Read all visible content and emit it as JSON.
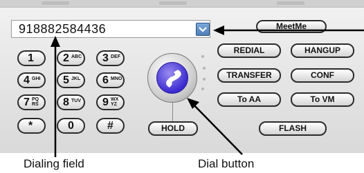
{
  "dial_field": {
    "value": "918882584436"
  },
  "keypad": [
    {
      "main": "1",
      "sub": ""
    },
    {
      "main": "2",
      "sub": "ABC"
    },
    {
      "main": "3",
      "sub": "DEF"
    },
    {
      "main": "4",
      "sub": "GHI"
    },
    {
      "main": "5",
      "sub": "JKL"
    },
    {
      "main": "6",
      "sub": "MNO"
    },
    {
      "main": "7",
      "sub": "PQ RS"
    },
    {
      "main": "8",
      "sub": "TUV"
    },
    {
      "main": "9",
      "sub": "WX YZ"
    },
    {
      "main": "*",
      "sub": ""
    },
    {
      "main": "0",
      "sub": ""
    },
    {
      "main": "#",
      "sub": ""
    }
  ],
  "buttons": {
    "meetme": "MeetMe",
    "redial": "REDIAL",
    "hangup": "HANGUP",
    "transfer": "TRANSFER",
    "conf": "CONF",
    "to_aa": "To AA",
    "to_vm": "To VM",
    "hold": "HOLD",
    "flash": "FLASH"
  },
  "annotations": {
    "dialing_field": "Dialing field",
    "dial_button": "Dial button"
  },
  "colors": {
    "dial_button": "#3a2bd0",
    "dropdown": "#5b8cc6"
  },
  "icons": {
    "dial": "phone-handset-icon",
    "dropdown": "chevron-down-icon"
  }
}
